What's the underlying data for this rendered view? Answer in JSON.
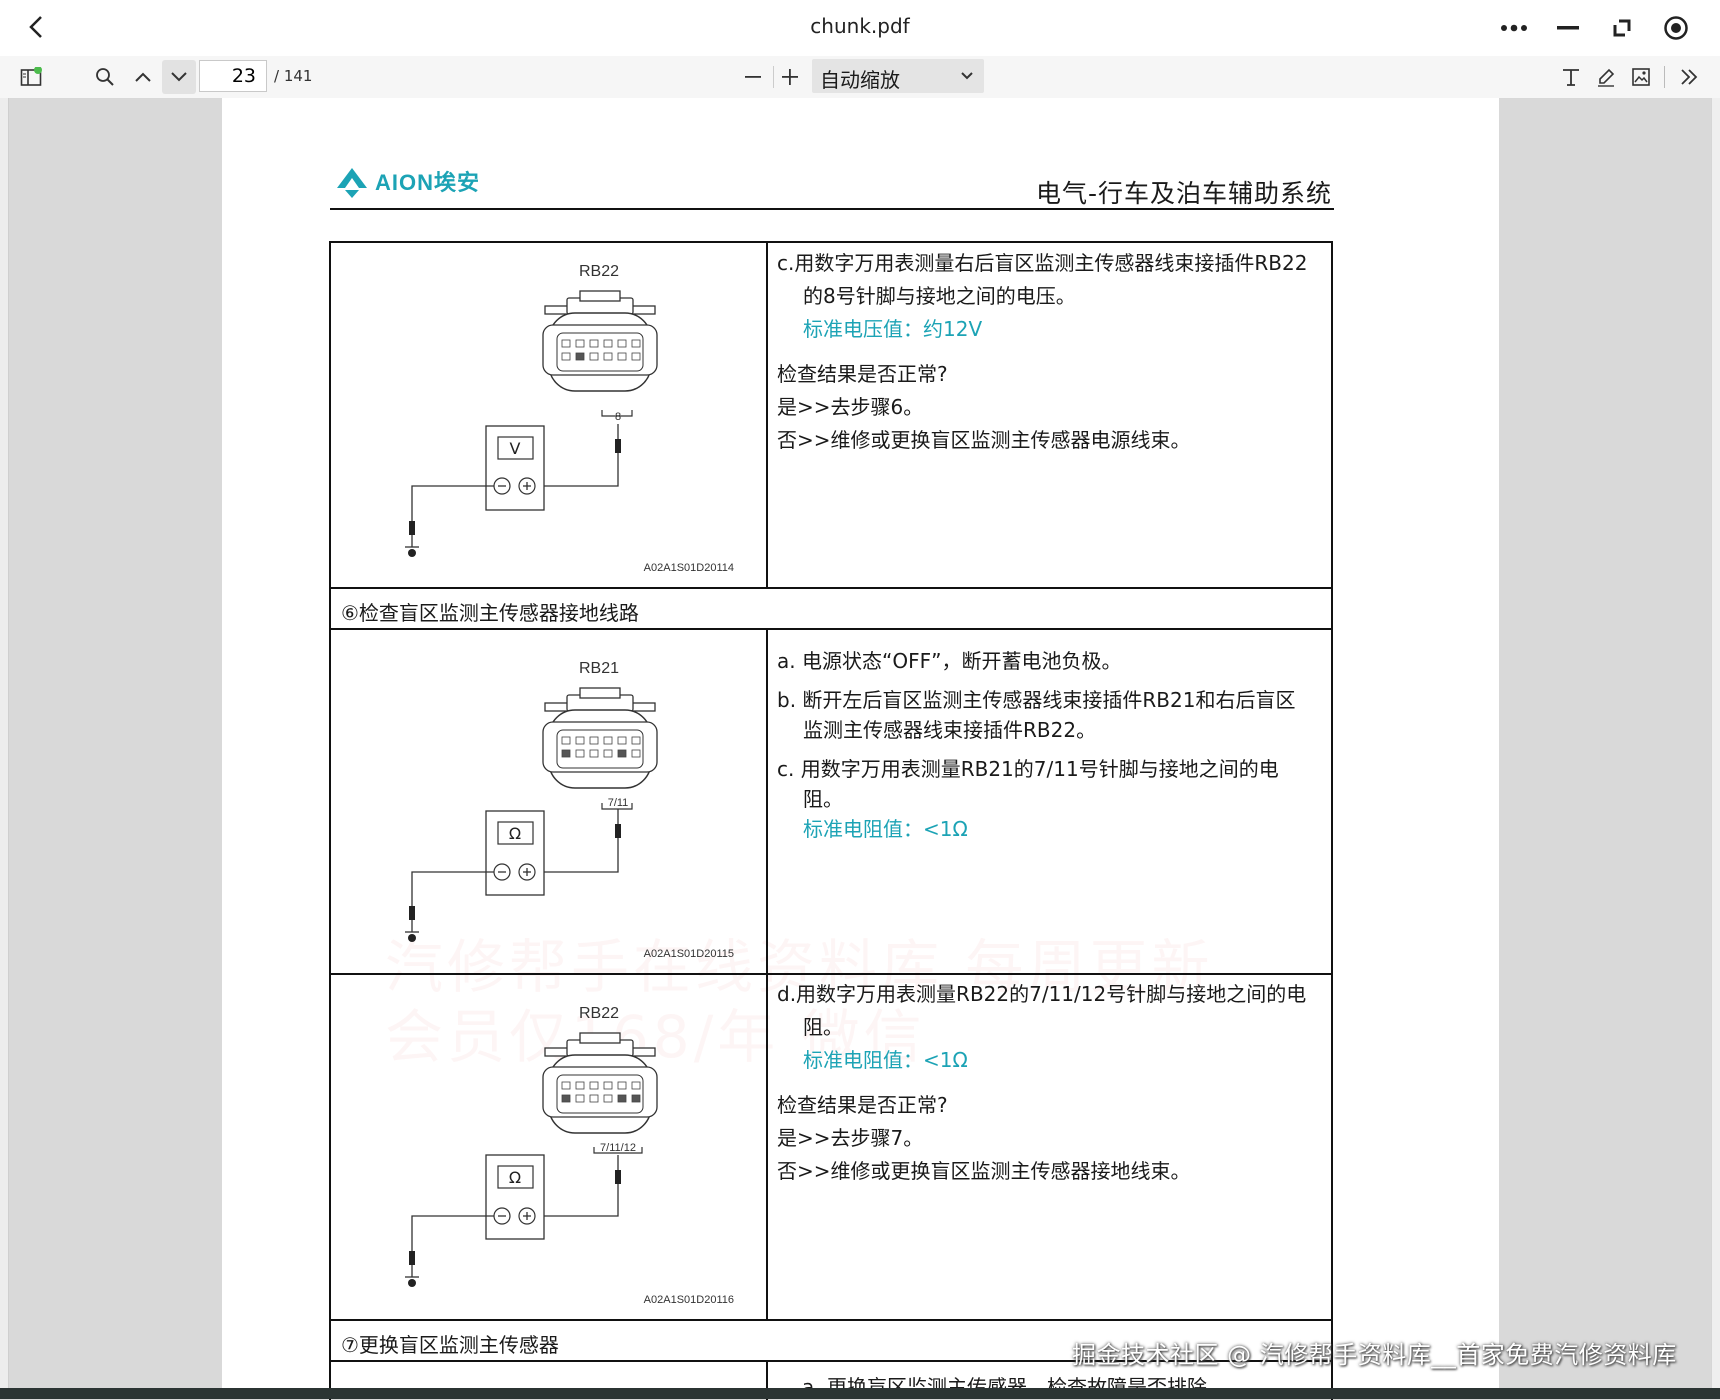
{
  "window": {
    "title": "chunk.pdf"
  },
  "toolbar": {
    "page_number": "23",
    "page_total": "/ 141",
    "zoom_label": "自动缩放"
  },
  "document": {
    "brand": "AION埃安",
    "section_title": "电气-行车及泊车辅助系统",
    "block1": {
      "connector": "RB22",
      "pin_label": "8",
      "meter_symbol": "V",
      "figure_code": "A02A1S01D20114",
      "line1": "c.用数字万用表测量右后盲区监测主传感器线束接插件RB22",
      "line2": "的8号针脚与接地之间的电压。",
      "standard": "标准电压值：约12V",
      "q": "检查结果是否正常?",
      "yes": "是>>去步骤6。",
      "no": "否>>维修或更换盲区监测主传感器电源线束。"
    },
    "step6_title": "⑥检查盲区监测主传感器接地线路",
    "block2": {
      "connector": "RB21",
      "pin_label": "7/11",
      "meter_symbol": "Ω",
      "figure_code": "A02A1S01D20115",
      "a": "a. 电源状态“OFF”，断开蓄电池负极。",
      "b1": "b. 断开左后盲区监测主传感器线束接插件RB21和右后盲区",
      "b2": "监测主传感器线束接插件RB22。",
      "c1": "c. 用数字万用表测量RB21的7/11号针脚与接地之间的电",
      "c2": "阻。",
      "standard": "标准电阻值：<1Ω"
    },
    "block3": {
      "connector": "RB22",
      "pin_label": "7/11/12",
      "meter_symbol": "Ω",
      "figure_code": "A02A1S01D20116",
      "d1": "d.用数字万用表测量RB22的7/11/12号针脚与接地之间的电",
      "d2": "阻。",
      "standard": "标准电阻值：<1Ω",
      "q": "检查结果是否正常?",
      "yes": "是>>去步骤7。",
      "no": "否>>维修或更换盲区监测主传感器接地线束。"
    },
    "step7_title": "⑦更换盲区监测主传感器",
    "cut_line": "a. 更换盲区监测主传感器，检查故障是否排除。",
    "watermark_lines": [
      "汽修帮手在线资料库 每周更新",
      "会员仅168/年 微信"
    ]
  },
  "overlay_watermark": "掘金技术社区 @ 汽修帮手资料库__首家免费汽修资料库",
  "colors": {
    "accent_teal": "#1ca3b5",
    "toolbar_bg": "#f6f6f6"
  }
}
